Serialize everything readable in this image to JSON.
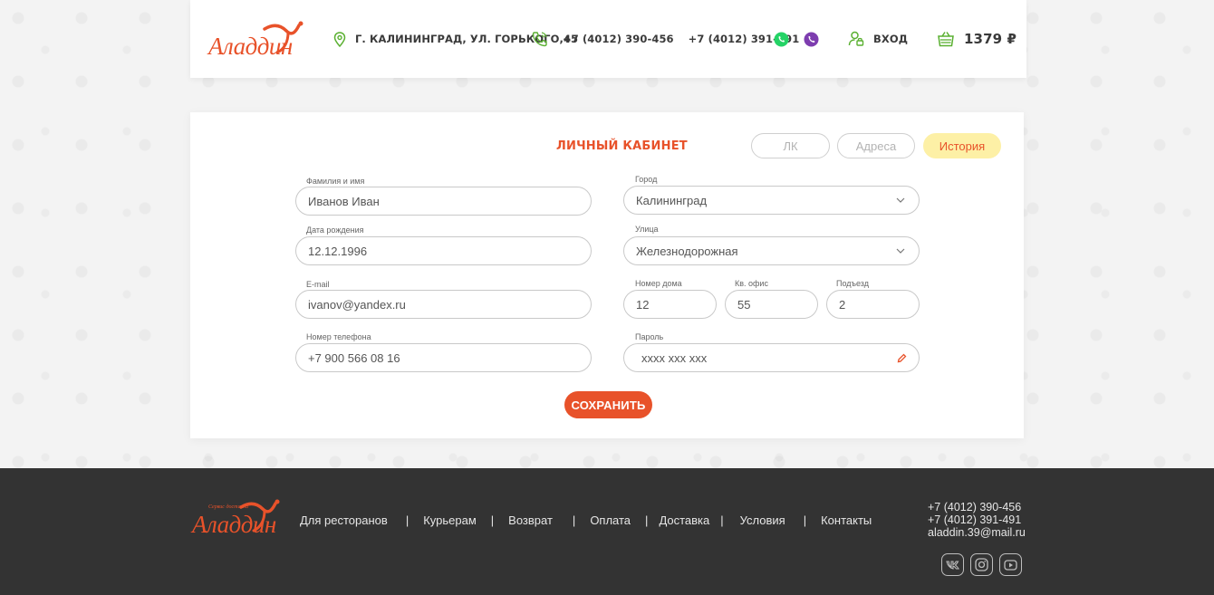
{
  "header": {
    "logo_text": "Аладдин",
    "address": "Г. КАЛИНИНГРАД, УЛ. ГОРЬКОГО,45",
    "phone1": "+7 (4012) 390-456",
    "phone2": "+7 (4012) 391-491",
    "login_label": "ВХОД",
    "cart_total": "1379 ₽",
    "colors": {
      "accent": "#e8522a",
      "whatsapp": "#25d366",
      "viber": "#7d3daf",
      "icon_green": "#5ab031"
    }
  },
  "account": {
    "title": "ЛИЧНЫЙ КАБИНЕТ",
    "tabs": [
      {
        "label": "ЛК",
        "active": false
      },
      {
        "label": "Адреса",
        "active": false
      },
      {
        "label": "История",
        "active": true
      }
    ],
    "fields": {
      "name": {
        "label": "Фамилия и  имя",
        "value": "Иванов Иван"
      },
      "birth": {
        "label": "Дата рождения",
        "value": "12.12.1996"
      },
      "email": {
        "label": "E-mail",
        "value": "ivanov@yandex.ru"
      },
      "phone": {
        "label": "Номер телефона",
        "value": "+7 900 566 08 16"
      },
      "city": {
        "label": "Город",
        "value": "Калининград"
      },
      "street": {
        "label": "Улица",
        "value": "Железнодорожная"
      },
      "house": {
        "label": "Номер дома",
        "value": "12"
      },
      "apt": {
        "label": "Кв. офис",
        "value": "55"
      },
      "entrance": {
        "label": "Подъезд",
        "value": "2"
      },
      "password": {
        "label": "Пароль",
        "value": "xxxx xxx xxx"
      }
    },
    "save_label": "СОХРАНИТЬ"
  },
  "footer": {
    "logo_text": "Аладдин",
    "logo_sub": "Сервис доставки",
    "nav": [
      "Для ресторанов",
      "Курьерам",
      "Возврат",
      "Оплата",
      "Доставка",
      "Условия",
      "Контакты"
    ],
    "phone1": "+7 (4012) 390-456",
    "phone2": "+7 (4012) 391-491",
    "email": "aladdin.39@mail.ru",
    "social": [
      "vk-icon",
      "instagram-icon",
      "youtube-icon"
    ]
  }
}
